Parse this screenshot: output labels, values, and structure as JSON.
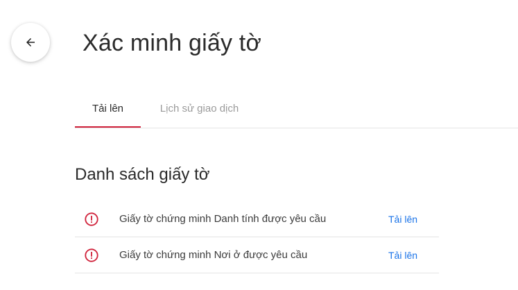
{
  "header": {
    "back_icon": "arrow-left-icon",
    "title": "Xác minh giấy tờ"
  },
  "tabs": [
    {
      "label": "Tải lên",
      "active": true
    },
    {
      "label": "Lịch sử giao dịch",
      "active": false
    }
  ],
  "documents": {
    "section_title": "Danh sách giấy tờ",
    "items": [
      {
        "label": "Giấy tờ chứng minh Danh tính được yêu cầu",
        "action": "Tải lên",
        "status_icon": "alert-circle-icon"
      },
      {
        "label": "Giấy tờ chứng minh Nơi ở được yêu cầu",
        "action": "Tải lên",
        "status_icon": "alert-circle-icon"
      }
    ]
  },
  "colors": {
    "accent": "#d0213a",
    "link": "#1a73e8",
    "alert": "#d0213a"
  }
}
